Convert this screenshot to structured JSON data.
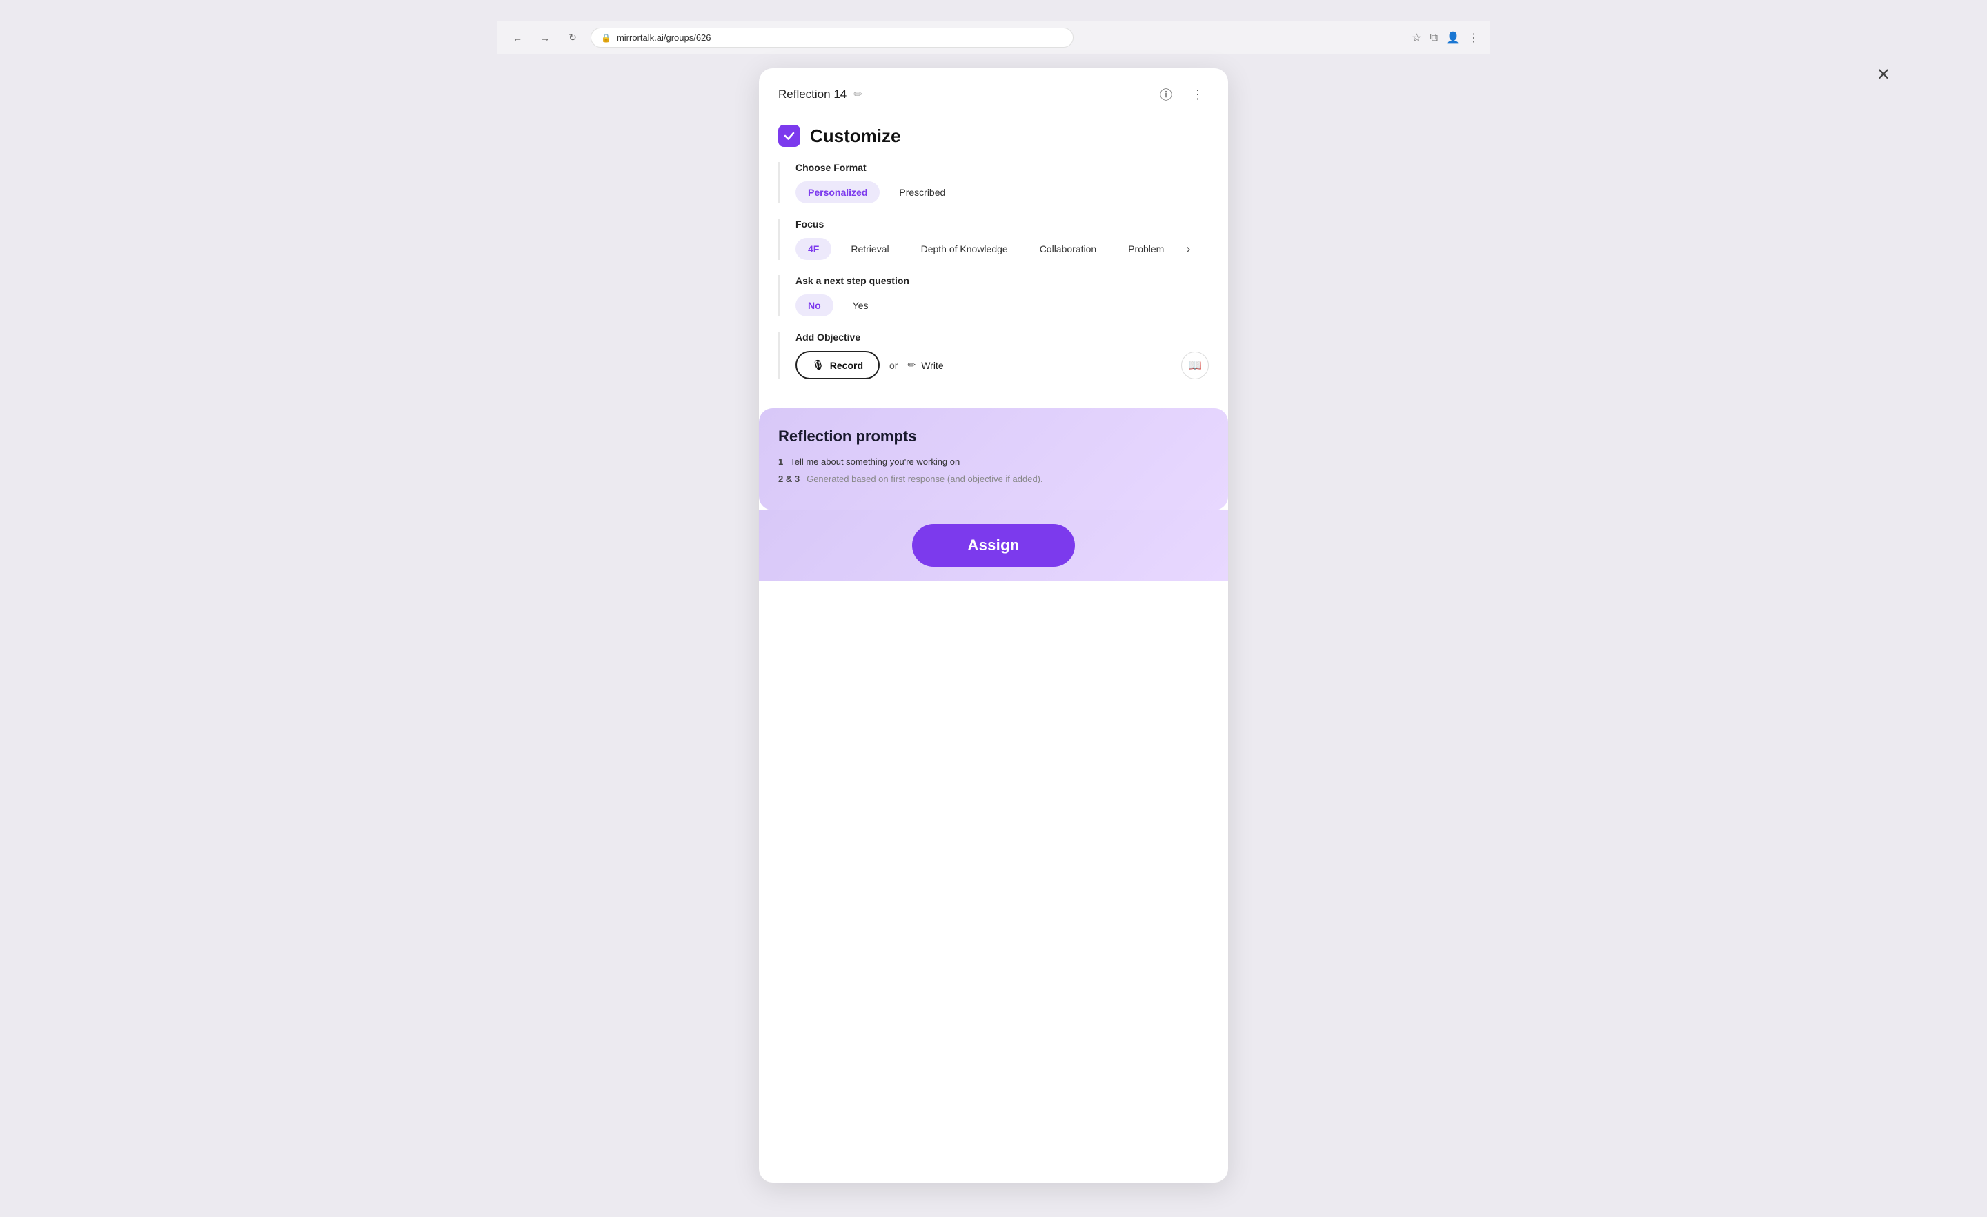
{
  "browser": {
    "url": "mirrortalk.ai/groups/626",
    "nav": {
      "back_icon": "←",
      "forward_icon": "→",
      "reload_icon": "↻",
      "lock_icon": "🔒"
    }
  },
  "modal": {
    "title": "Reflection 14",
    "edit_icon": "✏",
    "info_icon": "ⓘ",
    "more_icon": "⋮",
    "close_icon": "✕",
    "section_title": "Customize",
    "check_icon": "✓",
    "choose_format": {
      "label": "Choose Format",
      "options": [
        {
          "id": "personalized",
          "label": "Personalized",
          "active": true
        },
        {
          "id": "prescribed",
          "label": "Prescribed",
          "active": false
        }
      ]
    },
    "focus": {
      "label": "Focus",
      "options": [
        {
          "id": "4f",
          "label": "4F",
          "active": true
        },
        {
          "id": "retrieval",
          "label": "Retrieval",
          "active": false
        },
        {
          "id": "dok",
          "label": "Depth of Knowledge",
          "active": false
        },
        {
          "id": "collaboration",
          "label": "Collaboration",
          "active": false
        },
        {
          "id": "problem",
          "label": "Problem",
          "active": false
        }
      ],
      "scroll_arrow": "›"
    },
    "next_step": {
      "label": "Ask a next step question",
      "options": [
        {
          "id": "no",
          "label": "No",
          "active": true
        },
        {
          "id": "yes",
          "label": "Yes",
          "active": false
        }
      ]
    },
    "add_objective": {
      "label": "Add Objective",
      "record_label": "Record",
      "record_icon": "🎙",
      "or_text": "or",
      "write_label": "Write",
      "write_icon": "✏",
      "book_icon": "📖"
    }
  },
  "reflection_prompts": {
    "title": "Reflection prompts",
    "prompt1_num": "1",
    "prompt1_text": "Tell me about something you're working on",
    "prompt23_num": "2 & 3",
    "prompt23_text": "Generated based on first response (and objective if added)."
  },
  "assign_button": {
    "label": "Assign"
  }
}
